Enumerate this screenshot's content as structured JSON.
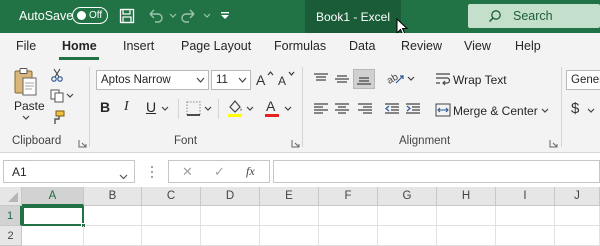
{
  "titlebar": {
    "autosave_label": "AutoSave",
    "autosave_state": "Off",
    "window_title": "Book1  -  Excel",
    "search_placeholder": "Search",
    "bg_color": "#217346"
  },
  "menu": {
    "items": [
      "File",
      "Home",
      "Insert",
      "Page Layout",
      "Formulas",
      "Data",
      "Review",
      "View",
      "Help"
    ],
    "active": "Home"
  },
  "ribbon": {
    "clipboard": {
      "label": "Clipboard",
      "paste_label": "Paste"
    },
    "font": {
      "label": "Font",
      "font_name": "Aptos Narrow",
      "font_size": "11",
      "bold": "B",
      "italic": "I",
      "underline": "U"
    },
    "alignment": {
      "label": "Alignment",
      "wrap_text": "Wrap Text",
      "merge_center": "Merge & Center"
    },
    "number": {
      "format": "Gener",
      "currency_symbol": "$"
    }
  },
  "formula_bar": {
    "name_box": "A1",
    "cancel_glyph": "✕",
    "enter_glyph": "✓",
    "fx_label": "fx",
    "content": ""
  },
  "grid": {
    "columns": [
      "A",
      "B",
      "C",
      "D",
      "E",
      "F",
      "G",
      "H",
      "I",
      "J"
    ],
    "rows": [
      "1",
      "2"
    ],
    "active_cell": "A1"
  }
}
